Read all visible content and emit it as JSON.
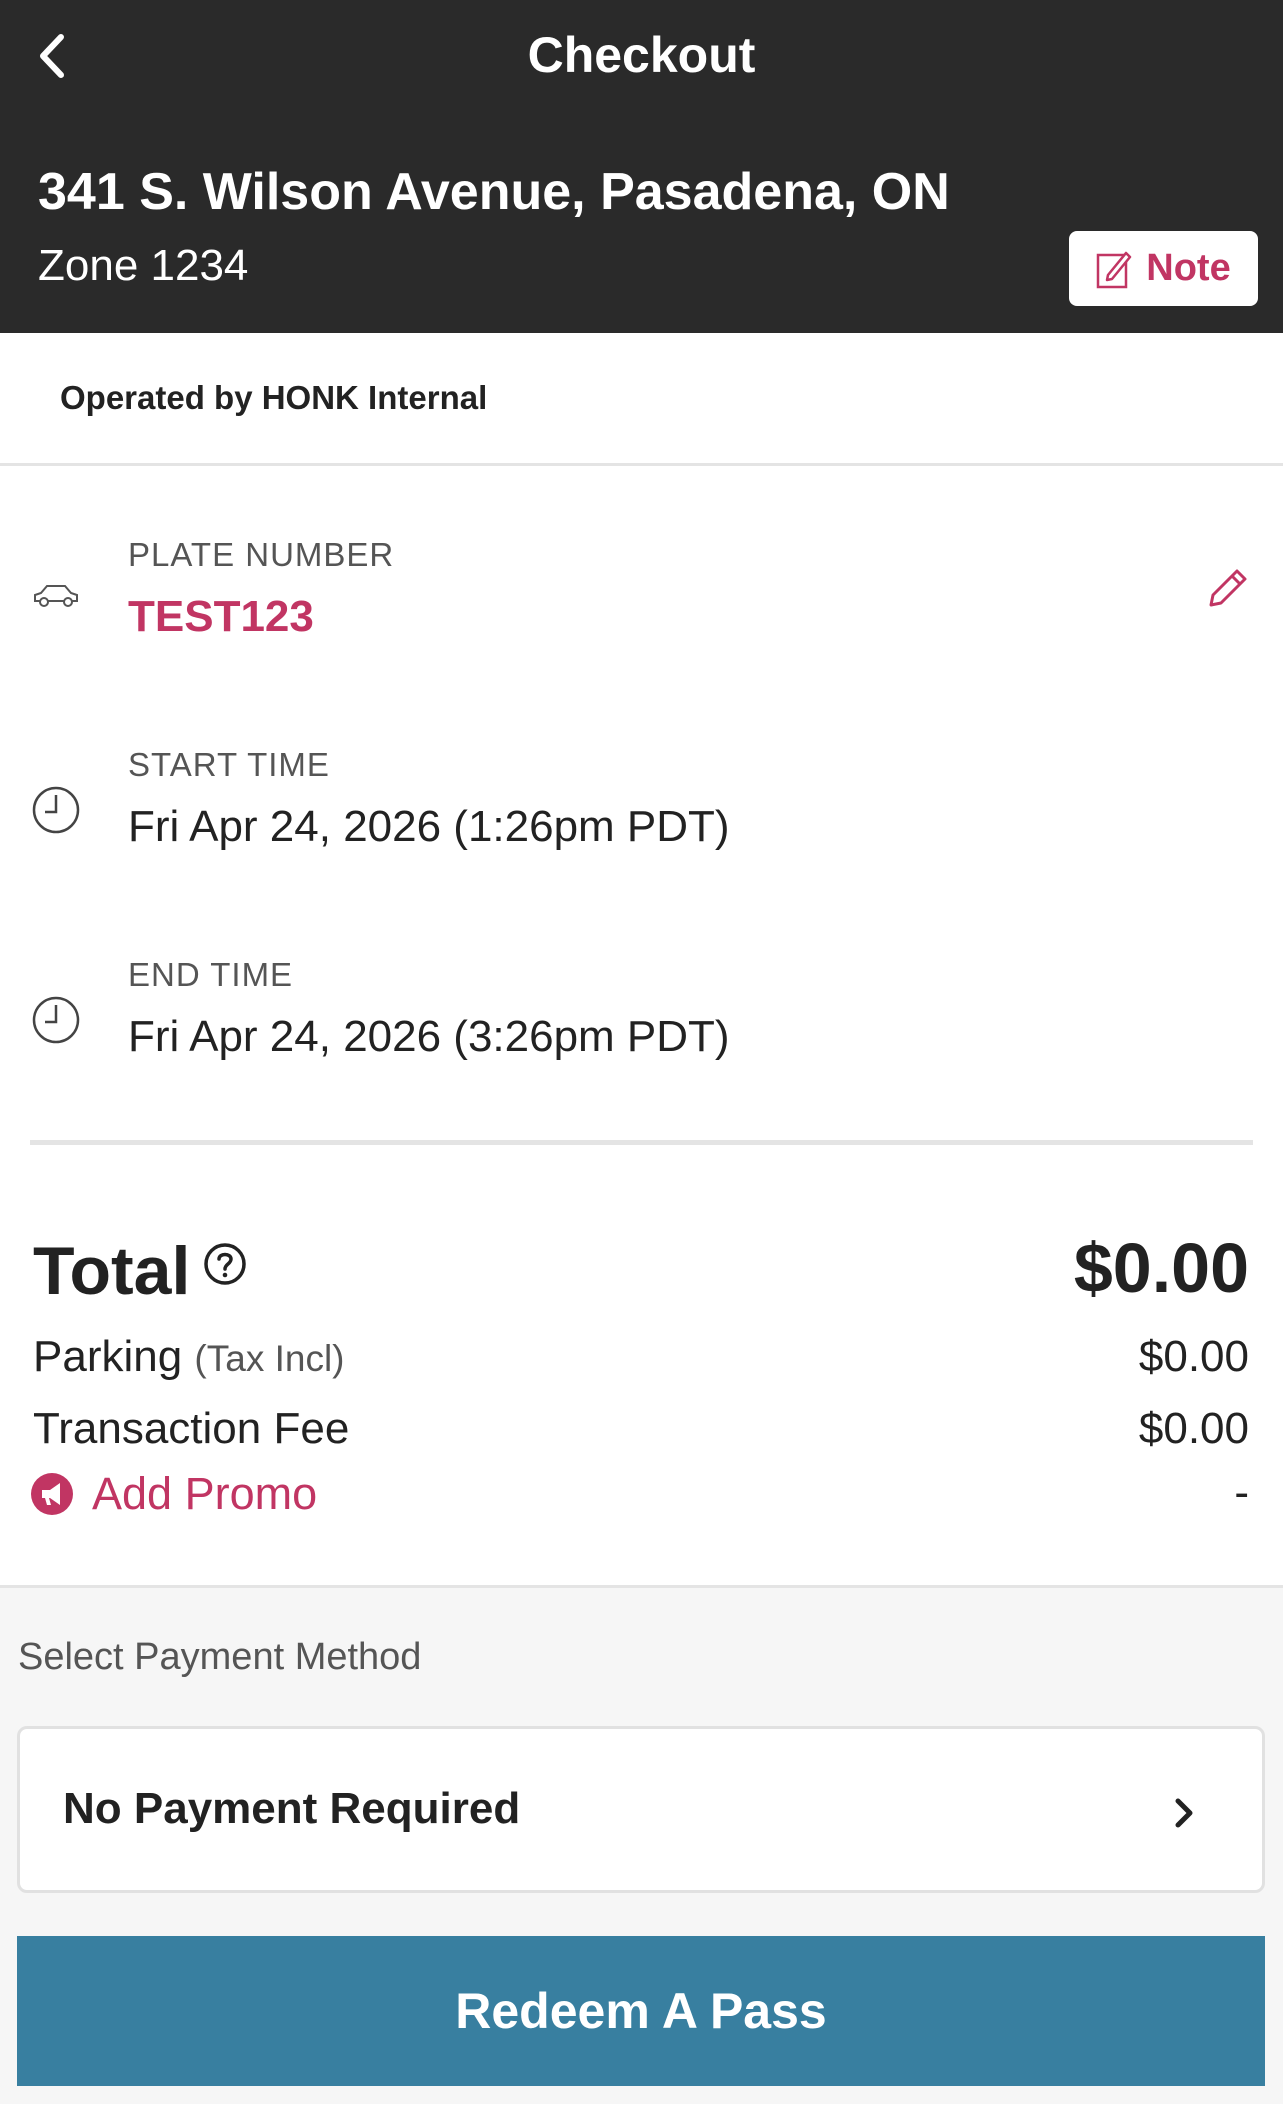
{
  "header": {
    "title": "Checkout",
    "address": "341 S. Wilson Avenue, Pasadena, ON",
    "zone": "Zone 1234",
    "note_label": "Note"
  },
  "operator": {
    "text": "Operated by HONK Internal"
  },
  "details": {
    "plate": {
      "label": "PLATE NUMBER",
      "value": "TEST123",
      "icon": "car-icon"
    },
    "start": {
      "label": "START TIME",
      "value": "Fri Apr 24, 2026 (1:26pm PDT)",
      "icon": "clock-icon"
    },
    "end": {
      "label": "END TIME",
      "value": "Fri Apr 24, 2026 (3:26pm PDT)",
      "icon": "clock-icon"
    }
  },
  "totals": {
    "total_label": "Total",
    "total_value": "$0.00",
    "parking_label": "Parking",
    "parking_note": "(Tax Incl)",
    "parking_value": "$0.00",
    "fee_label": "Transaction Fee",
    "fee_value": "$0.00",
    "promo_label": "Add Promo",
    "promo_value": "-"
  },
  "payment": {
    "heading": "Select Payment Method",
    "method": "No Payment Required",
    "redeem_label": "Redeem A Pass"
  },
  "colors": {
    "header_bg": "#2a2a2a",
    "accent": "#c13563",
    "button": "#387fa0"
  }
}
